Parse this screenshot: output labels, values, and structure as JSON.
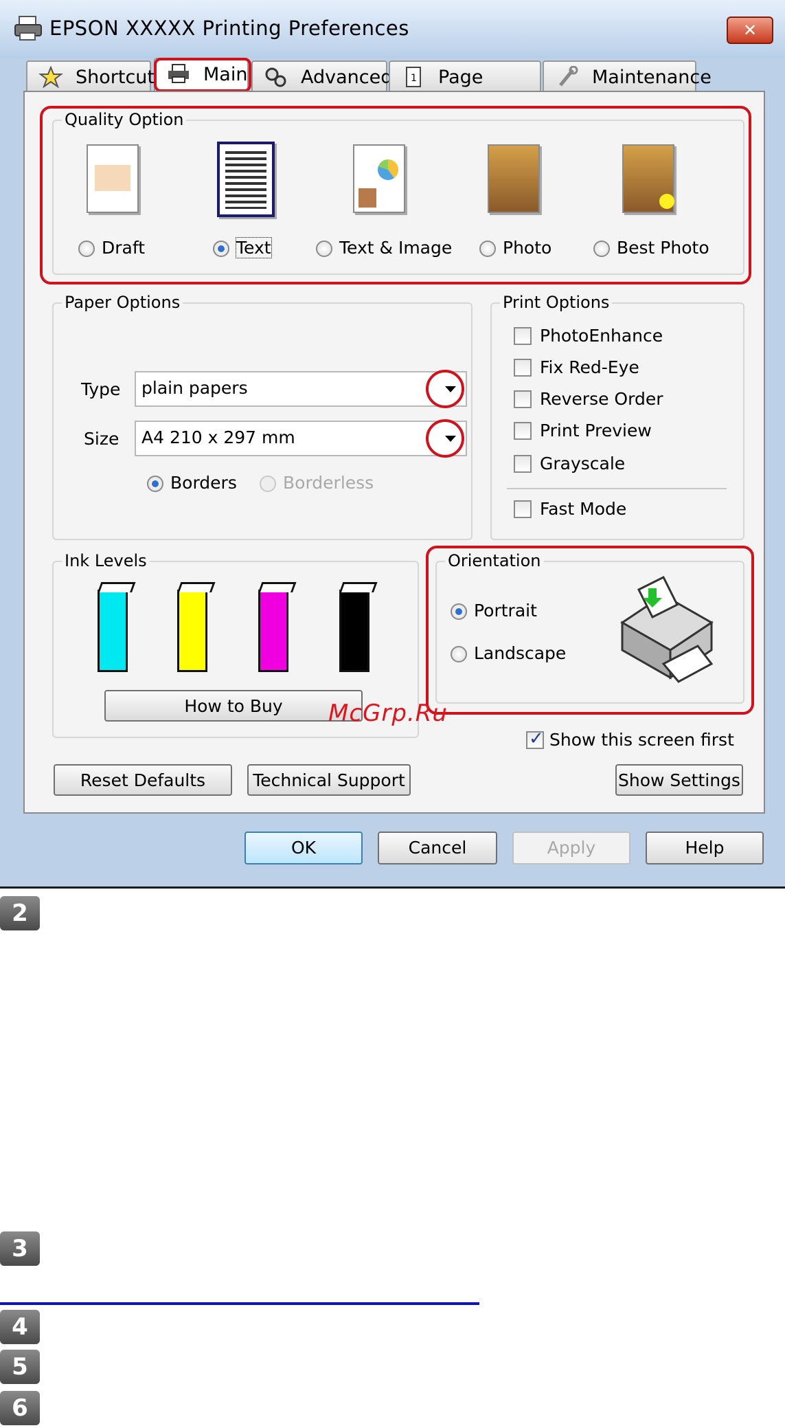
{
  "window": {
    "title": "EPSON XXXXX   Printing Preferences",
    "close_glyph": "✕"
  },
  "tabs": [
    {
      "label": "Shortcuts",
      "icon": "star-icon"
    },
    {
      "label": "Main",
      "icon": "printer-icon",
      "selected": true
    },
    {
      "label": "Advanced",
      "icon": "gears-icon"
    },
    {
      "label": "Page Layout",
      "icon": "page-icon"
    },
    {
      "label": "Maintenance",
      "icon": "wrench-icon"
    }
  ],
  "quality": {
    "legend": "Quality Option",
    "options": [
      {
        "label": "Draft",
        "selected": false
      },
      {
        "label": "Text",
        "selected": true
      },
      {
        "label": "Text & Image",
        "selected": false
      },
      {
        "label": "Photo",
        "selected": false
      },
      {
        "label": "Best Photo",
        "selected": false
      }
    ]
  },
  "paper": {
    "legend": "Paper Options",
    "type_label": "Type",
    "type_value": "plain papers",
    "size_label": "Size",
    "size_value": "A4 210 x 297 mm",
    "borders_label": "Borders",
    "borderless_label": "Borderless"
  },
  "print_options": {
    "legend": "Print Options",
    "items": [
      {
        "label": "PhotoEnhance",
        "checked": false
      },
      {
        "label": "Fix Red-Eye",
        "checked": false
      },
      {
        "label": "Reverse Order",
        "checked": false
      },
      {
        "label": "Print Preview",
        "checked": false
      },
      {
        "label": "Grayscale",
        "checked": false
      }
    ],
    "fast_mode": "Fast Mode"
  },
  "ink": {
    "legend": "Ink Levels",
    "colors": [
      "#00e8f0",
      "#ffff00",
      "#f000e0",
      "#000000"
    ],
    "how_to_buy": "How to Buy"
  },
  "orientation": {
    "legend": "Orientation",
    "portrait": "Portrait",
    "landscape": "Landscape"
  },
  "show_first": "Show this screen first",
  "buttons": {
    "reset": "Reset Defaults",
    "support": "Technical Support",
    "show_settings": "Show Settings",
    "ok": "OK",
    "cancel": "Cancel",
    "apply": "Apply",
    "help": "Help"
  },
  "watermark": "McGrp.Ru",
  "steps": [
    "2",
    "3",
    "4",
    "5",
    "6"
  ],
  "colors": {
    "highlight": "#d0121c",
    "link": "#1010d0"
  }
}
